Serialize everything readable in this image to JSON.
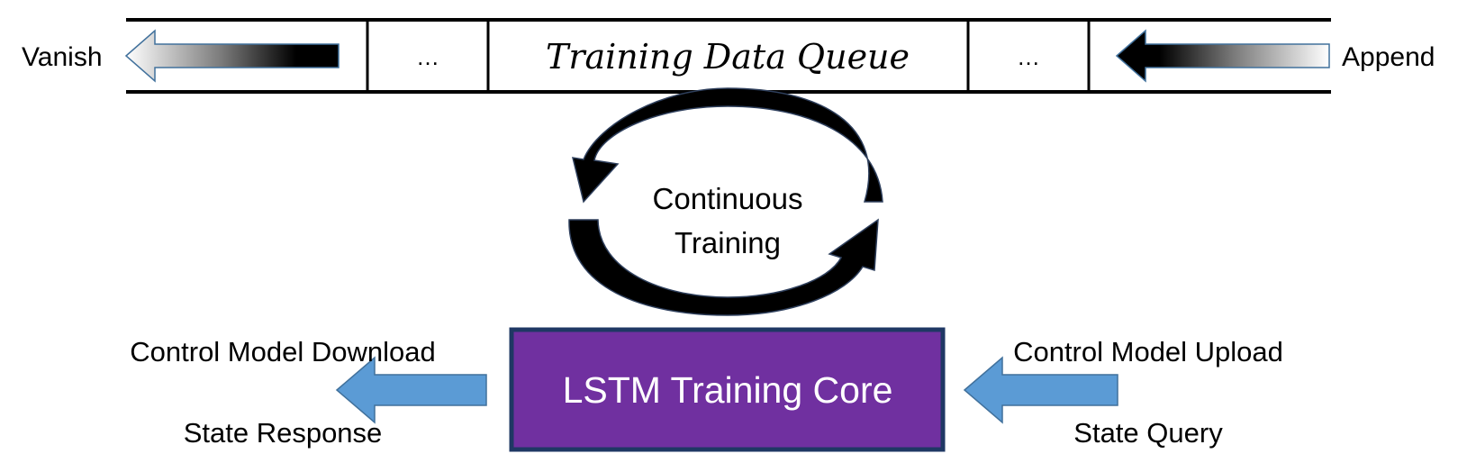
{
  "queue": {
    "title": "Training Data Queue",
    "cells": [
      "…",
      "…"
    ],
    "left_label": "Vanish",
    "right_label": "Append"
  },
  "cycle": {
    "label_line1": "Continuous",
    "label_line2": "Training"
  },
  "core": {
    "label": "LSTM Training Core"
  },
  "outputs": {
    "top": "Control Model Download",
    "bottom": "State Response"
  },
  "inputs": {
    "top": "Control Model Upload",
    "bottom": "State Query"
  },
  "colors": {
    "core_fill": "#7030a0",
    "core_border": "#1f3864",
    "flow_arrow": "#5b9bd5",
    "flow_arrow_border": "#41719c",
    "cycle_arrow": "#000000"
  }
}
